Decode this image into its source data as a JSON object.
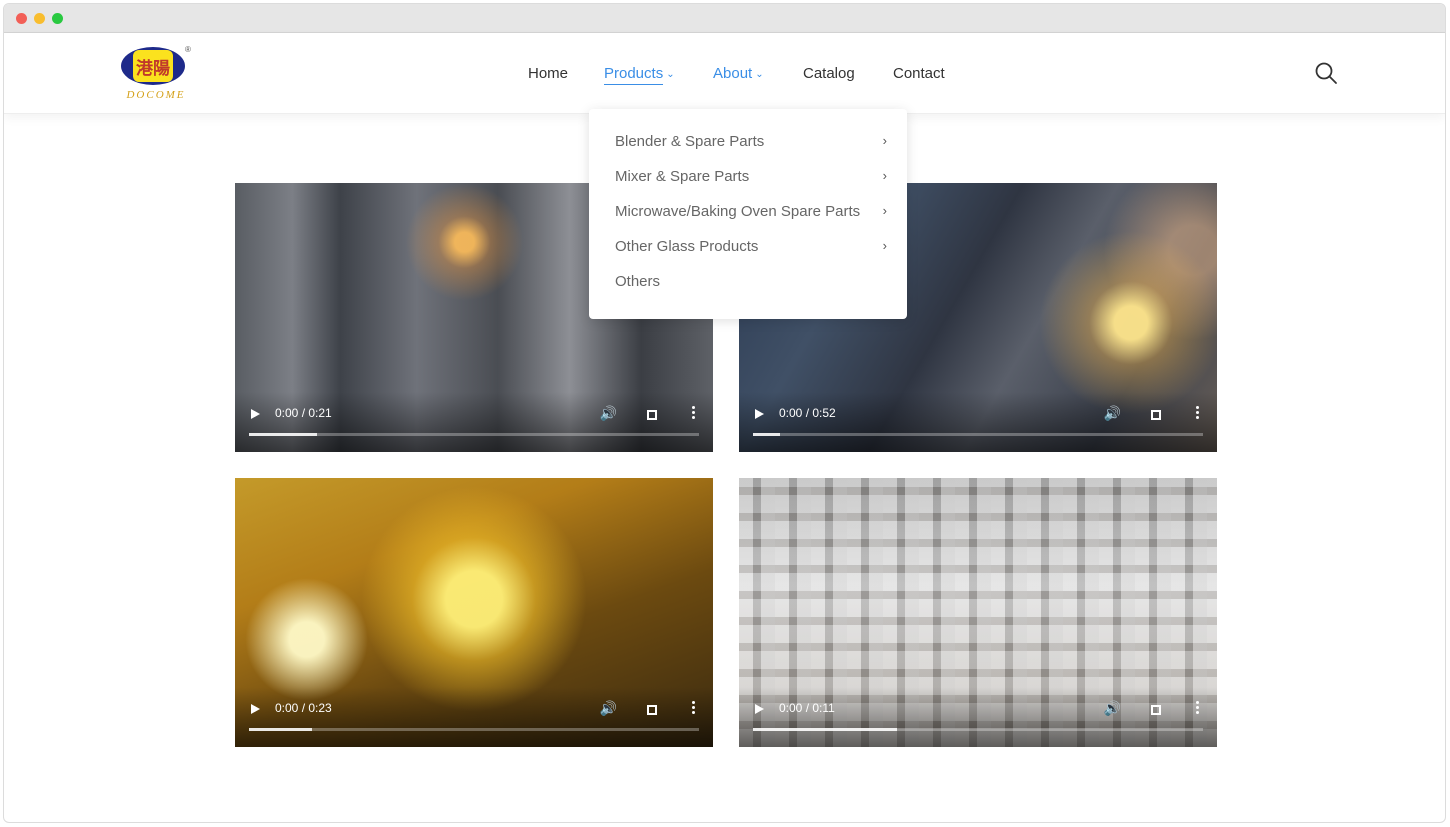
{
  "header": {
    "logo": {
      "brand_text": "DOCOME",
      "registered": "®",
      "glyph": "港陽"
    },
    "nav": [
      {
        "label": "Home"
      },
      {
        "label": "Products"
      },
      {
        "label": "About"
      },
      {
        "label": "Catalog"
      },
      {
        "label": "Contact"
      }
    ],
    "search_icon": "search-icon"
  },
  "products_menu": {
    "items": [
      {
        "label": "Blender & Spare Parts",
        "has_submenu": true
      },
      {
        "label": "Mixer & Spare Parts",
        "has_submenu": true
      },
      {
        "label": "Microwave/Baking Oven Spare Parts",
        "has_submenu": true
      },
      {
        "label": "Other Glass Products",
        "has_submenu": true
      },
      {
        "label": "Others",
        "has_submenu": false
      }
    ],
    "arrow_glyph": "›"
  },
  "videos": [
    {
      "time": "0:00 / 0:21",
      "buffered": 0.15
    },
    {
      "time": "0:00 / 0:52",
      "buffered": 0.06
    },
    {
      "time": "0:00 / 0:23",
      "buffered": 0.14
    },
    {
      "time": "0:00 / 0:11",
      "buffered": 0.32
    }
  ],
  "colors": {
    "accent": "#3a8ee6",
    "text": "#333333",
    "menu_text": "#666666"
  }
}
